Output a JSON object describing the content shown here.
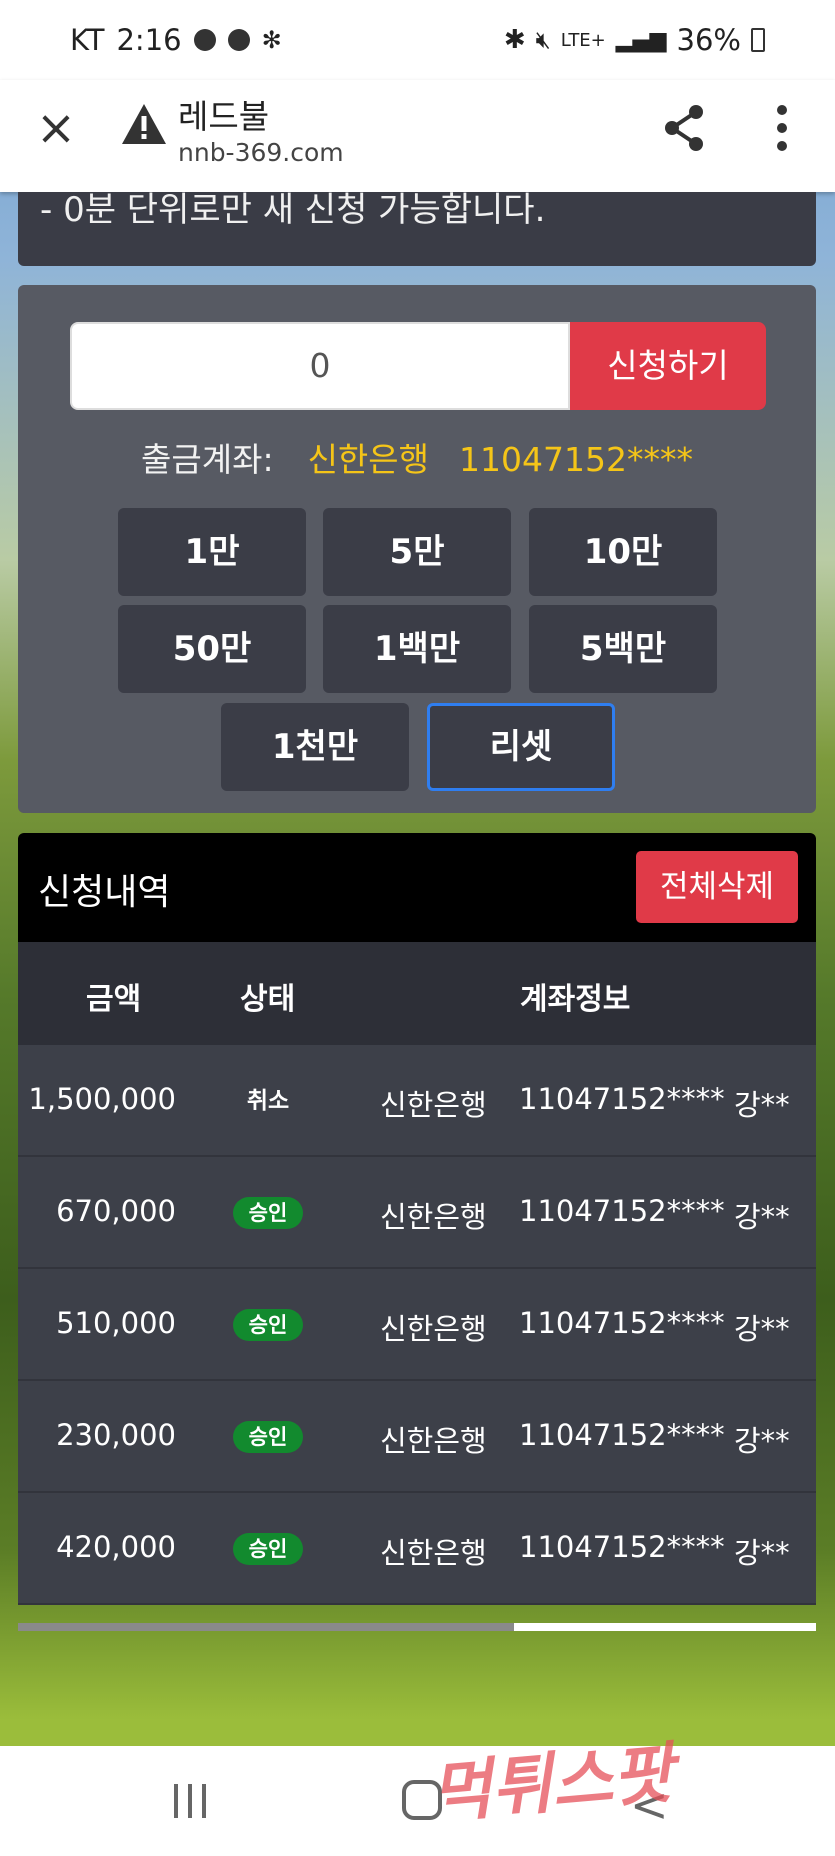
{
  "status_bar": {
    "carrier": "KT",
    "time": "2:16",
    "battery": "36%",
    "network": "LTE+"
  },
  "browser": {
    "title": "레드불",
    "url": "nnb-369.com"
  },
  "notice": {
    "text": "- 0분 단위로만 새 신청 가능합니다."
  },
  "withdraw": {
    "amount_value": "0",
    "apply_label": "신청하기",
    "account_label": "출금계좌:",
    "bank": "신한은행",
    "account_number": "11047152****",
    "quick_amounts": [
      "1만",
      "5만",
      "10만",
      "50만",
      "1백만",
      "5백만",
      "1천만"
    ],
    "reset_label": "리셋"
  },
  "history": {
    "title": "신청내역",
    "delete_all_label": "전체삭제",
    "columns": [
      "금액",
      "상태",
      "계좌정보"
    ],
    "rows": [
      {
        "amount": "1,500,000",
        "status": "취소",
        "bank": "신한은행",
        "account": "11047152****",
        "name": "강**"
      },
      {
        "amount": "670,000",
        "status": "승인",
        "bank": "신한은행",
        "account": "11047152****",
        "name": "강**"
      },
      {
        "amount": "510,000",
        "status": "승인",
        "bank": "신한은행",
        "account": "11047152****",
        "name": "강**"
      },
      {
        "amount": "230,000",
        "status": "승인",
        "bank": "신한은행",
        "account": "11047152****",
        "name": "강**"
      },
      {
        "amount": "420,000",
        "status": "승인",
        "bank": "신한은행",
        "account": "11047152****",
        "name": "강**"
      }
    ]
  },
  "watermark": "먹튀스팟",
  "colors": {
    "accent_red": "#e03a48",
    "account_yellow": "#f5c518",
    "approve_green": "#128a2e"
  }
}
